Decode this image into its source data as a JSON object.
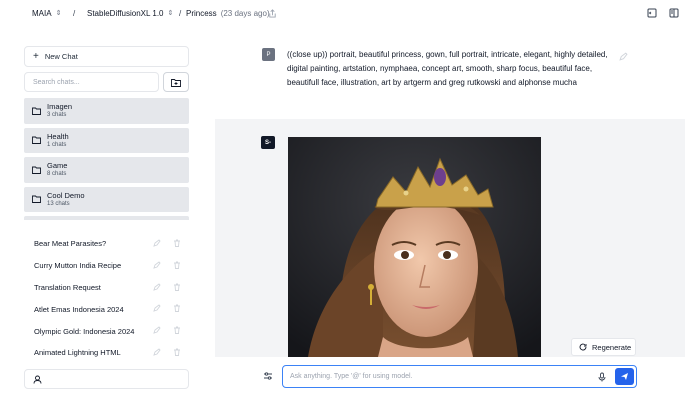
{
  "breadcrumb": {
    "app": "MAIA",
    "separator": "/",
    "model": "StableDiffusionXL 1.0",
    "chat_title": "Princess",
    "chat_age": "(23 days ago)"
  },
  "sidebar": {
    "new_chat_label": "New Chat",
    "search_placeholder": "Search chats...",
    "folders": [
      {
        "name": "Imagen",
        "count": "3 chats"
      },
      {
        "name": "Health",
        "count": "1 chats"
      },
      {
        "name": "Game",
        "count": "8 chats"
      },
      {
        "name": "Cool Demo",
        "count": "13 chats"
      }
    ],
    "chats": [
      "Bear Meat Parasites?",
      "Curry Mutton India Recipe",
      "Translation Request",
      "Atlet Emas Indonesia 2024",
      "Olympic Gold: Indonesia 2024",
      "Animated Lightning HTML"
    ]
  },
  "conversation": {
    "user_avatar": "P",
    "prompt": "((close up)) portrait, beautiful princess, gown, full portrait, intricate, elegant, highly detailed, digital painting, artstation, nymphaea, concept art, smooth, sharp focus, beautiful face, beautifull face, illustration, art by artgerm and greg rutkowski and alphonse mucha",
    "assistant_avatar": "S-",
    "regenerate_label": "Regenerate"
  },
  "composer": {
    "placeholder": "Ask anything.  Type '@' for using model."
  },
  "colors": {
    "accent": "#2563eb",
    "folder_bg": "#e5e7eb",
    "response_bg": "#f3f4f6"
  }
}
